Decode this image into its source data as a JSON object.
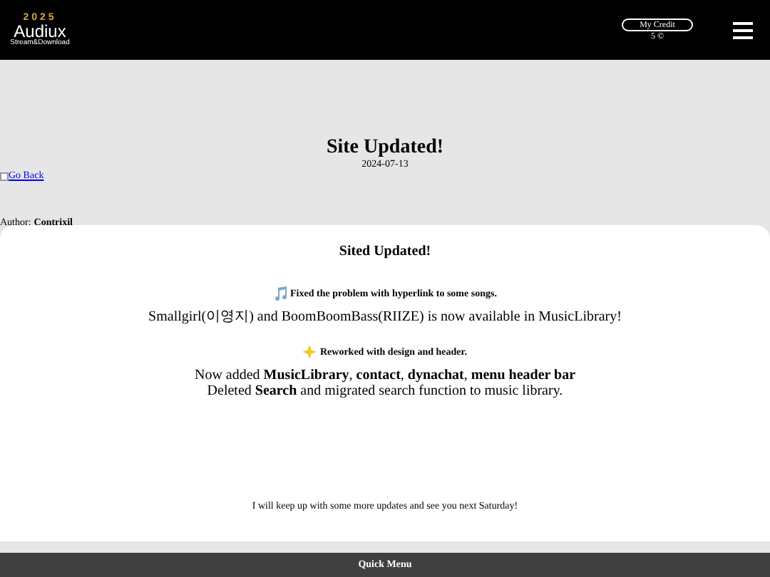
{
  "header": {
    "logo": {
      "year": "2025",
      "name": "Audiux",
      "tagline": "Stream&Download"
    },
    "credit": {
      "label": "My Credit",
      "amount": "5 ©"
    }
  },
  "post": {
    "title": "Site Updated!",
    "date": "2024-07-13",
    "back_link": "Go Back",
    "author_label": "Author:",
    "author": "Contrixil"
  },
  "card": {
    "title": "Sited Updated!",
    "sections": [
      {
        "kind": "music",
        "heading": "Fixed the problem with hyperlink to some songs.",
        "lines": [
          "Smallgirl(이영지) and BoomBoomBass(RIIZE) is now available in MusicLibrary!"
        ]
      },
      {
        "kind": "sparkle",
        "heading": "Reworked with design and header.",
        "lines": [
          "Now added **MusicLibrary**, **contact**, **dynachat**, **menu header bar**",
          "Deleted **Search** and migrated search function to music library."
        ]
      }
    ],
    "closing": "I will keep up with some more updates and see you next Saturday!"
  },
  "footer": {
    "title": "Quick Menu"
  }
}
